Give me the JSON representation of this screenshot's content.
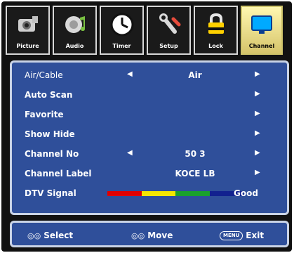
{
  "tabs": [
    {
      "label": "Picture",
      "icon": "camera-icon"
    },
    {
      "label": "Audio",
      "icon": "speaker-icon"
    },
    {
      "label": "Timer",
      "icon": "clock-icon"
    },
    {
      "label": "Setup",
      "icon": "wrench-icon"
    },
    {
      "label": "Lock",
      "icon": "lock-icon"
    },
    {
      "label": "Channel",
      "icon": "monitor-icon",
      "active": true
    }
  ],
  "menu": {
    "rows": [
      {
        "label": "Air/Cable",
        "left": "◀",
        "value": "Air",
        "right": "▶"
      },
      {
        "label": "Auto Scan",
        "right": "▶"
      },
      {
        "label": "Favorite",
        "right": "▶"
      },
      {
        "label": "Show Hide",
        "right": "▶"
      },
      {
        "label": "Channel No",
        "left": "◀",
        "value": "50 3",
        "right": "▶"
      },
      {
        "label": "Channel Label",
        "value": "KOCE LB",
        "right": "▶"
      },
      {
        "label": "DTV Signal",
        "value": "Good"
      }
    ],
    "signal_colors": [
      "#e00000",
      "#f4e600",
      "#1aa12c",
      "#12218f"
    ]
  },
  "footer": {
    "select_icon": "◎◎",
    "select": "Select",
    "move_icon": "◎◎",
    "move": "Move",
    "menu_key": "MENU",
    "exit": "Exit"
  }
}
